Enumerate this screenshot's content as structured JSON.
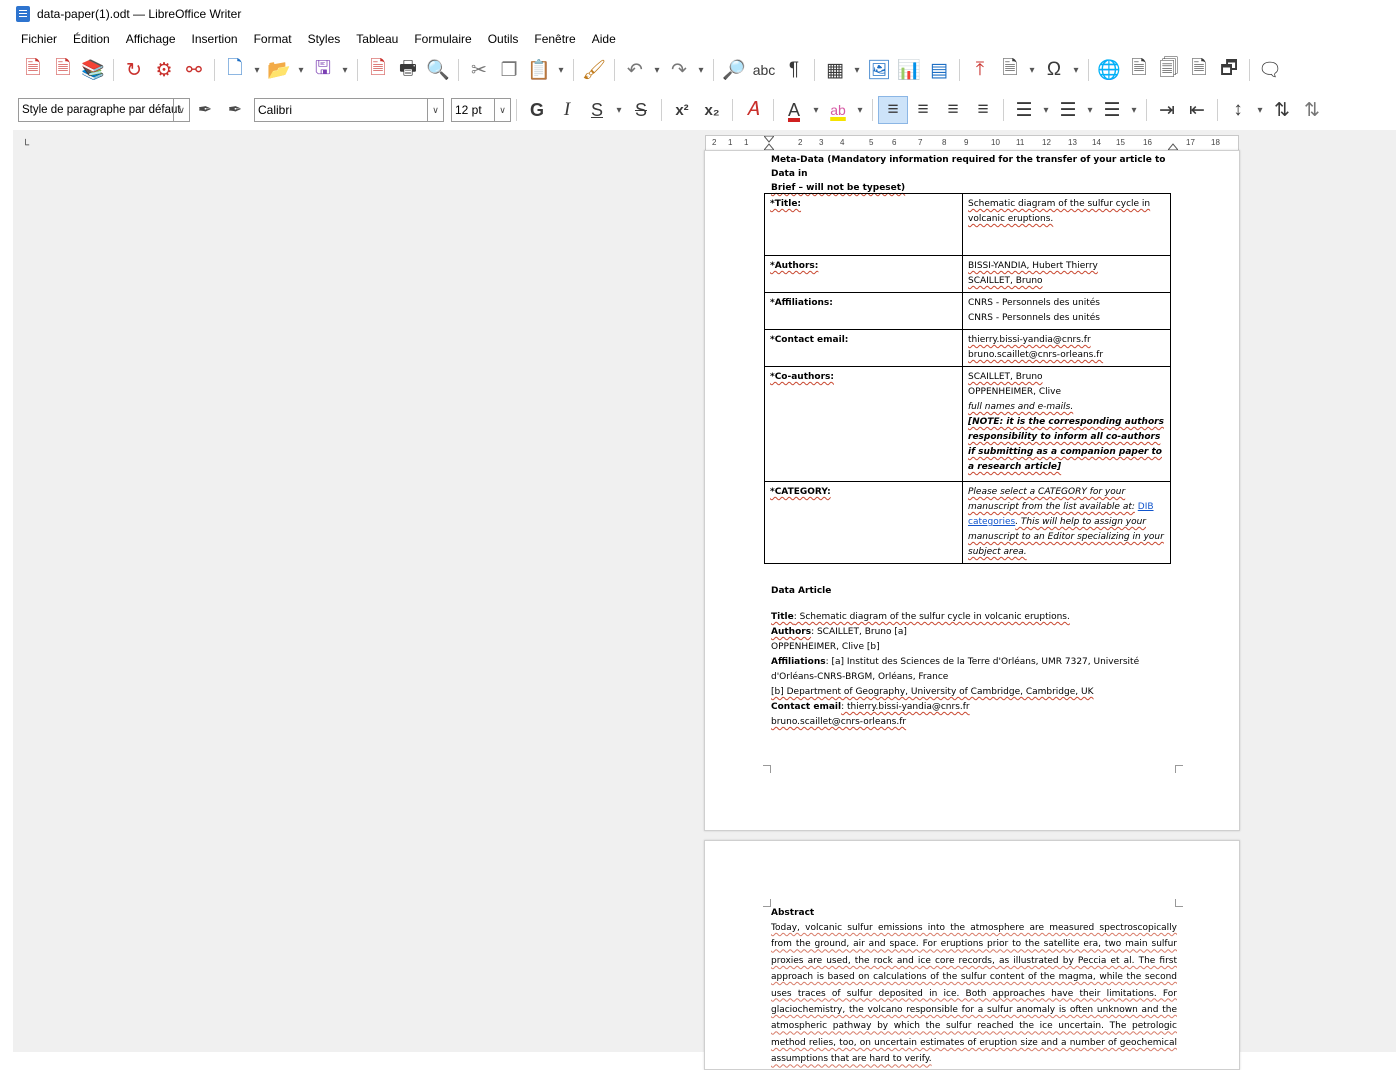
{
  "window": {
    "title": "data-paper(1).odt — LibreOffice Writer"
  },
  "menu": [
    "Fichier",
    "Édition",
    "Affichage",
    "Insertion",
    "Format",
    "Styles",
    "Tableau",
    "Formulaire",
    "Outils",
    "Fenêtre",
    "Aide"
  ],
  "formatting": {
    "paragraph_style": "Style de paragraphe par défaut",
    "font_name": "Calibri",
    "font_size": "12 pt",
    "bold": "G",
    "italic": "I",
    "underline": "S",
    "strike": "S",
    "superscript": "x²",
    "subscript": "x₂"
  },
  "ruler": {
    "labels": [
      "2",
      "1",
      "1",
      "2",
      "3",
      "4",
      "5",
      "6",
      "7",
      "8",
      "9",
      "10",
      "11",
      "12",
      "13",
      "14",
      "15",
      "16",
      "17",
      "18"
    ]
  },
  "document": {
    "meta_heading_line1": "Meta-Data (Mandatory information required for the transfer of your article to Data in",
    "meta_heading_line2": "Brief – will not be typeset)",
    "table": {
      "title_label": "*Title:",
      "title_value": "Schematic diagram of the sulfur cycle in volcanic eruptions.",
      "authors_label": "*Authors:",
      "authors_1": "BISSI-YANDIA, Hubert Thierry",
      "authors_2": "SCAILLET, Bruno",
      "affiliations_label": "*Affiliations:",
      "affiliations_1": "CNRS - Personnels des unités",
      "affiliations_2": "CNRS - Personnels des unités",
      "contact_label": "*Contact email:",
      "contact_1": "thierry.bissi-yandia@cnrs.fr",
      "contact_2": "bruno.scaillet@cnrs-orleans.fr",
      "coauthors_label": "*Co-authors:",
      "coauthors_1": "SCAILLET, Bruno",
      "coauthors_2": "OPPENHEIMER, Clive",
      "coauthors_hint": "full names and e-mails.",
      "coauthors_note": "[NOTE: it is the corresponding authors responsibility to inform all co-authors if submitting as a companion paper to a research article]",
      "category_label": "*CATEGORY:",
      "category_text_1": "Please select a CATEGORY for your manuscript from the list available at:",
      "category_link": "DIB categories",
      "category_text_2": ". This will help to assign your manuscript to an Editor specializing in your subject area."
    },
    "article": {
      "heading": "Data Article",
      "title_label": "Title",
      "title_value": ": Schematic diagram of the sulfur cycle in volcanic eruptions.",
      "authors_label": "Authors",
      "authors_value": ": SCAILLET, Bruno [a]",
      "authors_2": "OPPENHEIMER, Clive [b]",
      "affiliations_label": "Affiliations",
      "affiliations_value": ": [a] Institut des Sciences de la Terre d'Orléans, UMR 7327, Université d'Orléans-CNRS-BRGM, Orléans, France",
      "affiliations_2": "[b] Department of Geography, University of Cambridge, Cambridge, UK",
      "contact_label": "Contact email",
      "contact_value": ": thierry.bissi-yandia@cnrs.fr",
      "contact_2": "bruno.scaillet@cnrs-orleans.fr"
    },
    "abstract": {
      "heading": "Abstract",
      "text": "Today, volcanic sulfur emissions into the atmosphere are measured spectroscopically from the ground, air and space. For eruptions prior to the satellite era, two main sulfur proxies are used, the rock and ice core records, as illustrated by Peccia et al. The first approach is based on calculations of the sulfur content of the magma, while the second uses traces of sulfur deposited in ice. Both approaches have their limitations. For glaciochemistry, the volcano responsible for a sulfur anomaly is often unknown and the atmospheric pathway by which the sulfur reached the ice uncertain. The petrologic method relies, too, on uncertain estimates of eruption size and a number of geochemical assumptions that are hard to verify."
    }
  }
}
